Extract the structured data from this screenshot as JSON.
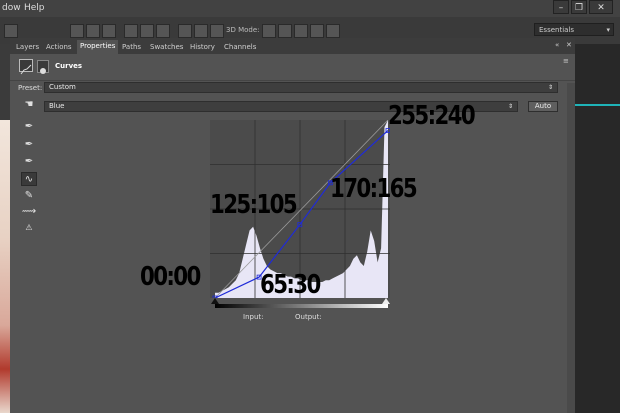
{
  "menubar": {
    "items": [
      "dow",
      "Help"
    ]
  },
  "optionsbar": {
    "mode_label": "3D Mode:"
  },
  "workspace": {
    "value": "Essentials"
  },
  "panel": {
    "tabs": [
      "Layers",
      "Actions",
      "Properties",
      "Paths",
      "Swatches",
      "History",
      "Channels"
    ],
    "active_tab": "Properties",
    "close": "✕",
    "collapse": "«",
    "menu": "≡"
  },
  "properties": {
    "title": "Curves",
    "preset_label": "Preset:",
    "preset_value": "Custom",
    "channel_value": "Blue",
    "auto_label": "Auto",
    "input_label": "Input:",
    "output_label": "Output:"
  },
  "window_controls": {
    "minimize": "–",
    "restore": "❐",
    "close": "✕"
  },
  "colors": {
    "curve": "#1f2bd8",
    "histogram": "#e8e6f6",
    "panel": "#535353",
    "accent": "#1fb3b8"
  },
  "curve_points": [
    {
      "label": "00:00",
      "input": 0,
      "output": 0
    },
    {
      "label": "65:30",
      "input": 65,
      "output": 30
    },
    {
      "label": "125:105",
      "input": 125,
      "output": 105
    },
    {
      "label": "170:165",
      "input": 170,
      "output": 165
    },
    {
      "label": "255:240",
      "input": 255,
      "output": 240
    }
  ],
  "histogram": [
    3,
    3,
    4,
    5,
    6,
    8,
    10,
    14,
    22,
    30,
    38,
    40,
    35,
    28,
    22,
    18,
    16,
    15,
    14,
    14,
    13,
    12,
    12,
    11,
    11,
    10,
    10,
    10,
    9,
    9,
    9,
    9,
    10,
    10,
    11,
    12,
    13,
    14,
    16,
    18,
    22,
    24,
    20,
    18,
    26,
    38,
    32,
    20,
    28,
    96,
    100
  ]
}
